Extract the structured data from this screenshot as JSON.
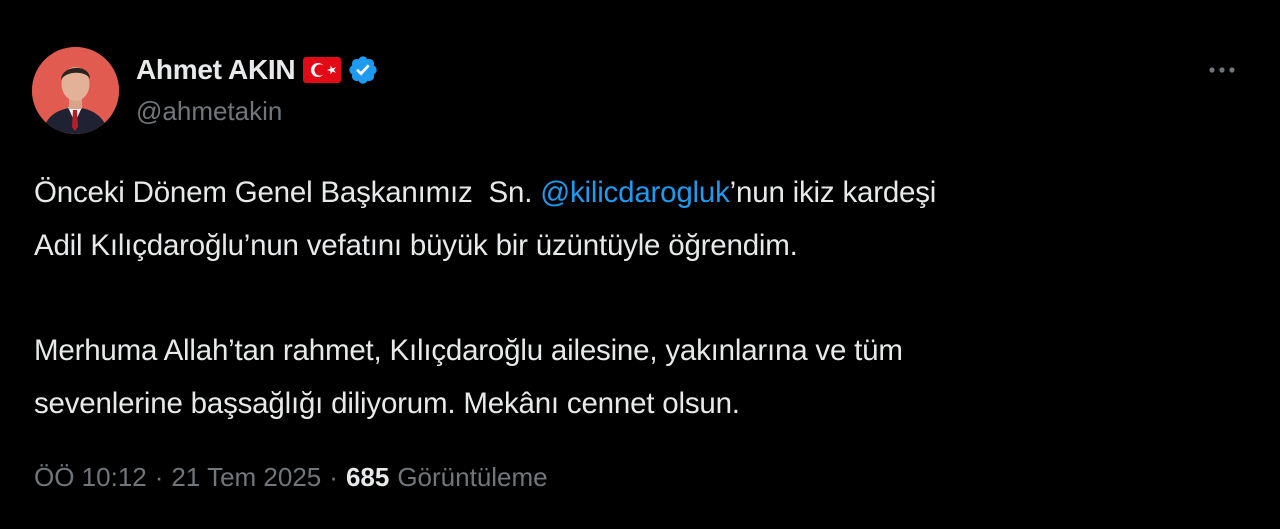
{
  "author": {
    "display_name": "Ahmet AKIN",
    "handle": "@ahmetakin",
    "flag_icon": "turkey-flag-icon",
    "verified_icon": "verified-badge-icon"
  },
  "tweet": {
    "line1_prefix": "Önceki Dönem Genel Başkanımız  Sn. ",
    "mention": "@kilicdarogluk",
    "line1_suffix": "’nun ikiz kardeşi",
    "line2": "Adil Kılıçdaroğlu’nun vefatını büyük bir üzüntüyle öğrendim.",
    "line3": "Merhuma Allah’tan rahmet, Kılıçdaroğlu ailesine, yakınlarına ve tüm",
    "line4": "sevenlerine başsağlığı diliyorum. Mekânı cennet olsun."
  },
  "meta": {
    "time": "ÖÖ 10:12",
    "separator": "·",
    "date": "21 Tem 2025",
    "views_count": "685",
    "views_label": "Görüntüleme"
  },
  "colors": {
    "background": "#000000",
    "text": "#e7e9ea",
    "secondary": "#71767b",
    "link": "#1d9bf0",
    "flag_red": "#e30a17"
  }
}
